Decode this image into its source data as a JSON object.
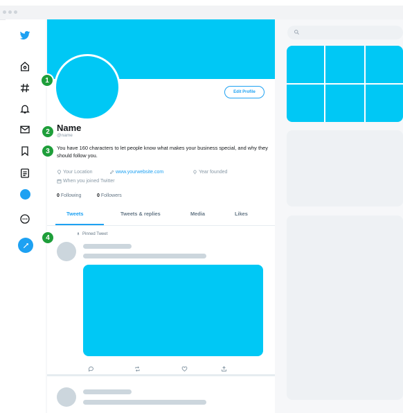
{
  "profile": {
    "name": "Name",
    "handle": "@name",
    "bio": "You have 160 characters to let people know what makes your business special, and why they should follow you.",
    "location": "Your Location",
    "website": "www.yourwebsite.com",
    "founded": "Year founded",
    "joined": "When you joined Twitter",
    "following_count": "0",
    "following_label": "Following",
    "followers_count": "0",
    "followers_label": "Followers",
    "edit_profile_label": "Edit Profile"
  },
  "tabs": [
    {
      "label": "Tweets",
      "active": true
    },
    {
      "label": "Tweets & replies",
      "active": false
    },
    {
      "label": "Media",
      "active": false
    },
    {
      "label": "Likes",
      "active": false
    }
  ],
  "pinned_label": "Pinned Tweet",
  "badges": [
    "1",
    "2",
    "3",
    "4"
  ],
  "nav_icons": [
    "twitter-logo-icon",
    "home-icon",
    "hashtag-icon",
    "bell-icon",
    "mail-icon",
    "bookmark-icon",
    "list-icon",
    "profile-avatar-icon",
    "more-icon",
    "compose-tweet-icon"
  ],
  "tweet_actions": [
    "reply-icon",
    "retweet-icon",
    "like-icon",
    "share-icon"
  ],
  "colors": {
    "brand_blue": "#1da1f2",
    "banner_cyan": "#00c8f5",
    "badge_green": "#1e9e3a",
    "skeleton_gray": "#ccd6dd"
  }
}
